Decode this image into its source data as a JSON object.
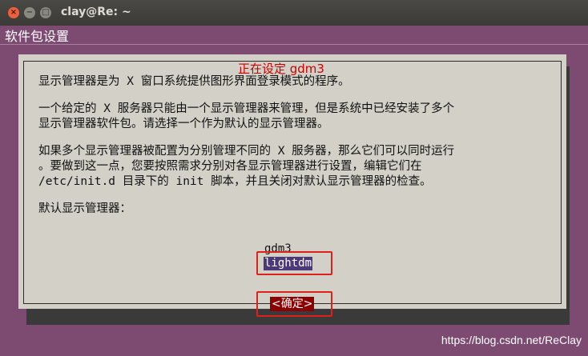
{
  "window": {
    "title": "clay@Re: ~",
    "close_glyph": "×",
    "min_glyph": "−",
    "max_glyph": "□"
  },
  "terminal": {
    "backtitle": "软件包设置",
    "dialog": {
      "title": "正在设定 gdm3",
      "paragraph1": "显示管理器是为 X 窗口系统提供图形界面登录模式的程序。",
      "paragraph2_line1": "一个给定的 X 服务器只能由一个显示管理器来管理，但是系统中已经安装了多个",
      "paragraph2_line2": "显示管理器软件包。请选择一个作为默认的显示管理器。",
      "paragraph3_line1": "如果多个显示管理器被配置为分别管理不同的 X 服务器，那么它们可以同时运行",
      "paragraph3_line2": "。要做到这一点，您要按照需求分别对各显示管理器进行设置，编辑它们在",
      "paragraph3_line3": "/etc/init.d 目录下的 init 脚本，并且关闭对默认显示管理器的检查。",
      "prompt": "默认显示管理器：",
      "options": [
        "gdm3",
        "lightdm"
      ],
      "selected": "lightdm",
      "ok_label": "<确定>"
    }
  },
  "watermark": "https://blog.csdn.net/ReClay"
}
